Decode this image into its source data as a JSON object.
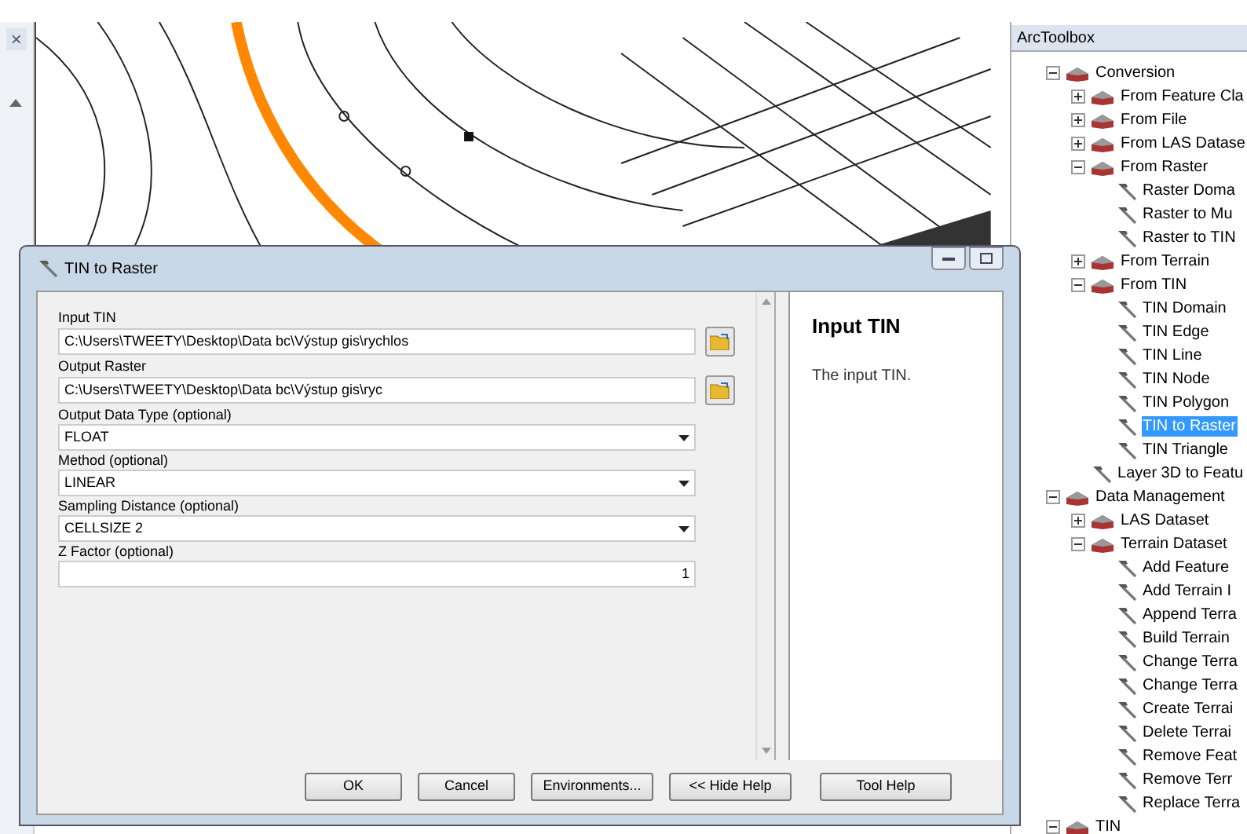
{
  "map_window": {
    "close_glyph": "×"
  },
  "dialog": {
    "title": "TIN to Raster",
    "fields": [
      {
        "kind": "path",
        "label": "Input TIN",
        "value": "C:\\Users\\TWEETY\\Desktop\\Data bc\\Výstup gis\\rychlos"
      },
      {
        "kind": "path",
        "label": "Output Raster",
        "value": "C:\\Users\\TWEETY\\Desktop\\Data bc\\Výstup gis\\ryc"
      },
      {
        "kind": "dropdown",
        "label": "Output Data Type (optional)",
        "value": "FLOAT"
      },
      {
        "kind": "dropdown",
        "label": "Method (optional)",
        "value": "LINEAR"
      },
      {
        "kind": "dropdown",
        "label": "Sampling Distance (optional)",
        "value": "CELLSIZE 2"
      },
      {
        "kind": "number",
        "label": "Z Factor (optional)",
        "value": "1"
      }
    ],
    "help": {
      "title": "Input TIN",
      "text": "The input TIN."
    },
    "buttons": [
      "OK",
      "Cancel",
      "Environments...",
      "<< Hide Help",
      "Tool Help"
    ]
  },
  "toolbox": {
    "title": "ArcToolbox",
    "tree": [
      {
        "kind": "toolbox",
        "label": "Conversion",
        "expanded": true,
        "children": [
          {
            "kind": "toolset",
            "label": "From Feature Cla",
            "expanded": false
          },
          {
            "kind": "toolset",
            "label": "From File",
            "expanded": false
          },
          {
            "kind": "toolset",
            "label": "From LAS Datase",
            "expanded": false
          },
          {
            "kind": "toolset",
            "label": "From Raster",
            "expanded": true,
            "children": [
              {
                "kind": "tool",
                "label": "Raster Doma",
                "selected": false
              },
              {
                "kind": "tool",
                "label": "Raster to Mu",
                "selected": false
              },
              {
                "kind": "tool",
                "label": "Raster to TIN",
                "selected": false
              }
            ]
          },
          {
            "kind": "toolset",
            "label": "From Terrain",
            "expanded": false
          },
          {
            "kind": "toolset",
            "label": "From TIN",
            "expanded": true,
            "children": [
              {
                "kind": "tool",
                "label": "TIN Domain",
                "selected": false
              },
              {
                "kind": "tool",
                "label": "TIN Edge",
                "selected": false
              },
              {
                "kind": "tool",
                "label": "TIN Line",
                "selected": false
              },
              {
                "kind": "tool",
                "label": "TIN Node",
                "selected": false
              },
              {
                "kind": "tool",
                "label": "TIN Polygon",
                "selected": false
              },
              {
                "kind": "tool",
                "label": "TIN to Raster",
                "selected": true
              },
              {
                "kind": "tool",
                "label": "TIN Triangle",
                "selected": false
              }
            ]
          },
          {
            "kind": "tool",
            "label": "Layer 3D to Featu",
            "selected": false
          }
        ]
      },
      {
        "kind": "toolbox",
        "label": "Data Management",
        "expanded": true,
        "children": [
          {
            "kind": "toolset",
            "label": "LAS Dataset",
            "expanded": false
          },
          {
            "kind": "toolset",
            "label": "Terrain Dataset",
            "expanded": true,
            "children": [
              {
                "kind": "tool",
                "label": "Add Feature",
                "selected": false
              },
              {
                "kind": "tool",
                "label": "Add Terrain I",
                "selected": false
              },
              {
                "kind": "tool",
                "label": "Append Terra",
                "selected": false
              },
              {
                "kind": "tool",
                "label": "Build Terrain",
                "selected": false
              },
              {
                "kind": "tool",
                "label": "Change Terra",
                "selected": false
              },
              {
                "kind": "tool",
                "label": "Change Terra",
                "selected": false
              },
              {
                "kind": "tool",
                "label": "Create Terrai",
                "selected": false
              },
              {
                "kind": "tool",
                "label": "Delete Terrai",
                "selected": false
              },
              {
                "kind": "tool",
                "label": "Remove Feat",
                "selected": false
              },
              {
                "kind": "tool",
                "label": "Remove Terr",
                "selected": false
              },
              {
                "kind": "tool",
                "label": "Replace Terra",
                "selected": false
              }
            ]
          }
        ]
      },
      {
        "kind": "toolbox",
        "label": "TIN",
        "expanded": true
      }
    ]
  }
}
